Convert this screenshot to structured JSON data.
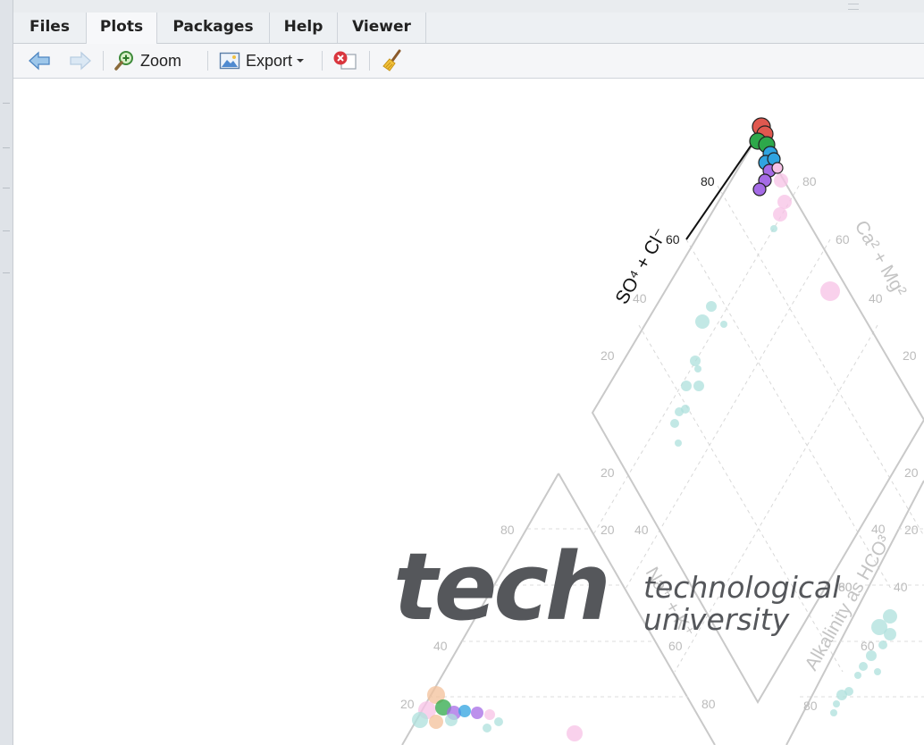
{
  "tabs": [
    {
      "label": "Files",
      "active": false
    },
    {
      "label": "Plots",
      "active": true
    },
    {
      "label": "Packages",
      "active": false
    },
    {
      "label": "Help",
      "active": false
    },
    {
      "label": "Viewer",
      "active": false
    }
  ],
  "toolbar": {
    "back_icon": "arrow-left-icon",
    "forward_icon": "arrow-right-icon",
    "zoom_label": "Zoom",
    "export_label": "Export",
    "remove_icon": "remove-plot-icon",
    "clear_icon": "broom-icon"
  },
  "plot": {
    "diamond_left_axis_label": "SO⁴ + Cl⁻",
    "diamond_right_axis_label": "Ca² + Mg²",
    "left_triangle_axis_label": "Na⁺ + K⁺",
    "right_triangle_axis_label": "Alkalinity as HCO³",
    "ticks": {
      "diamond_upper_left": [
        "80",
        "60",
        "40",
        "20"
      ],
      "diamond_upper_right": [
        "80",
        "60",
        "40",
        "20"
      ],
      "diamond_lower_left": [
        "20"
      ],
      "diamond_lower_right": [
        "20",
        "40",
        "60",
        "80"
      ],
      "left_triangle": [
        "80",
        "20",
        "40",
        "40",
        "20",
        "60",
        "80"
      ],
      "right_triangle": [
        "20",
        "40",
        "60",
        "80"
      ]
    },
    "colors": {
      "red": "#e0584f",
      "green": "#2da84a",
      "blue": "#2fa3e0",
      "purple": "#a56be6",
      "pink": "#f7c2e6",
      "teal": "#aee0dc",
      "orange": "#f3c09a",
      "grid": "#c9c9c9"
    }
  },
  "watermark": {
    "word": "tech",
    "line1": "technological",
    "line2": "university"
  }
}
